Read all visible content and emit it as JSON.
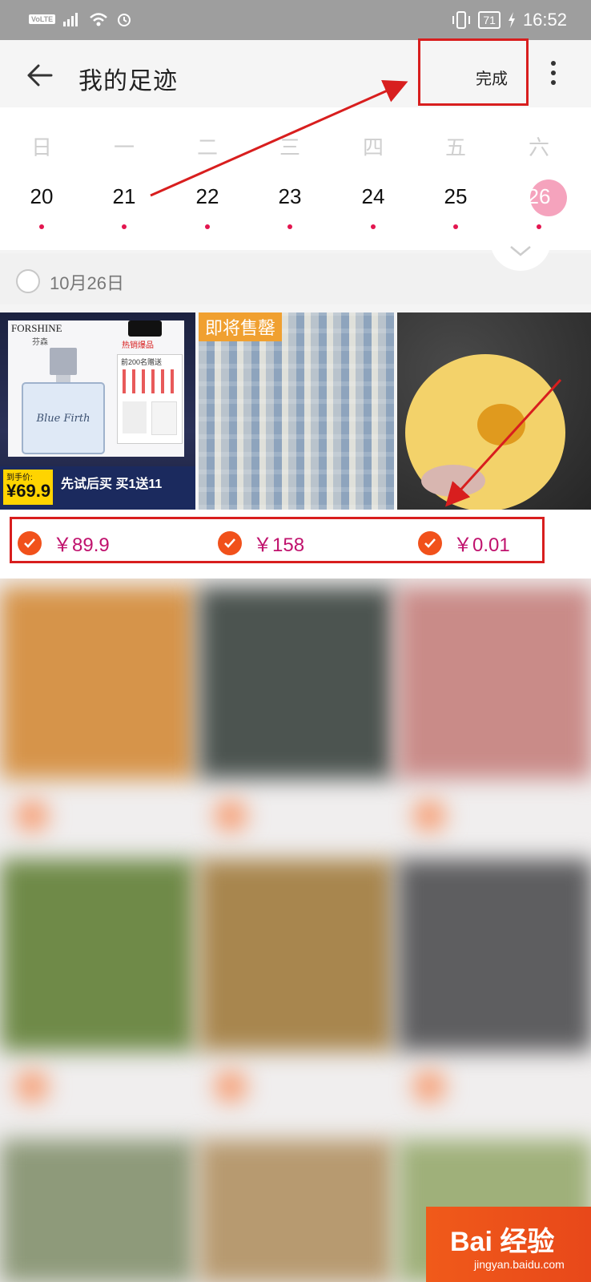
{
  "status_bar": {
    "network": "VoLTE",
    "battery": "71",
    "time": "16:52"
  },
  "header": {
    "title": "我的足迹",
    "done_label": "完成"
  },
  "calendar": {
    "weekdays": [
      "日",
      "一",
      "二",
      "三",
      "四",
      "五",
      "六"
    ],
    "dates": [
      "20",
      "21",
      "22",
      "23",
      "24",
      "25",
      "26"
    ],
    "selected_index": 6
  },
  "date_group": {
    "label": "10月26日"
  },
  "products": [
    {
      "price": "￥89.9",
      "brand": "FORSHINE",
      "brand_cn": "芬森",
      "script": "Blue Firth",
      "badge": "热销爆品",
      "gift": "前200名赠送",
      "promo_price_label": "到手价:",
      "promo_price": "¥69.9",
      "promo_text": "先试后买 买1送11"
    },
    {
      "price": "￥158",
      "tag": "即将售罄"
    },
    {
      "price": "￥0.01"
    }
  ],
  "watermark": {
    "text": "Bai 经验",
    "sub": "jingyan.baidu.com"
  },
  "colors": {
    "accent": "#e3154f",
    "price": "#c0126d",
    "check": "#f1511b",
    "annotation": "#d81e1e"
  }
}
